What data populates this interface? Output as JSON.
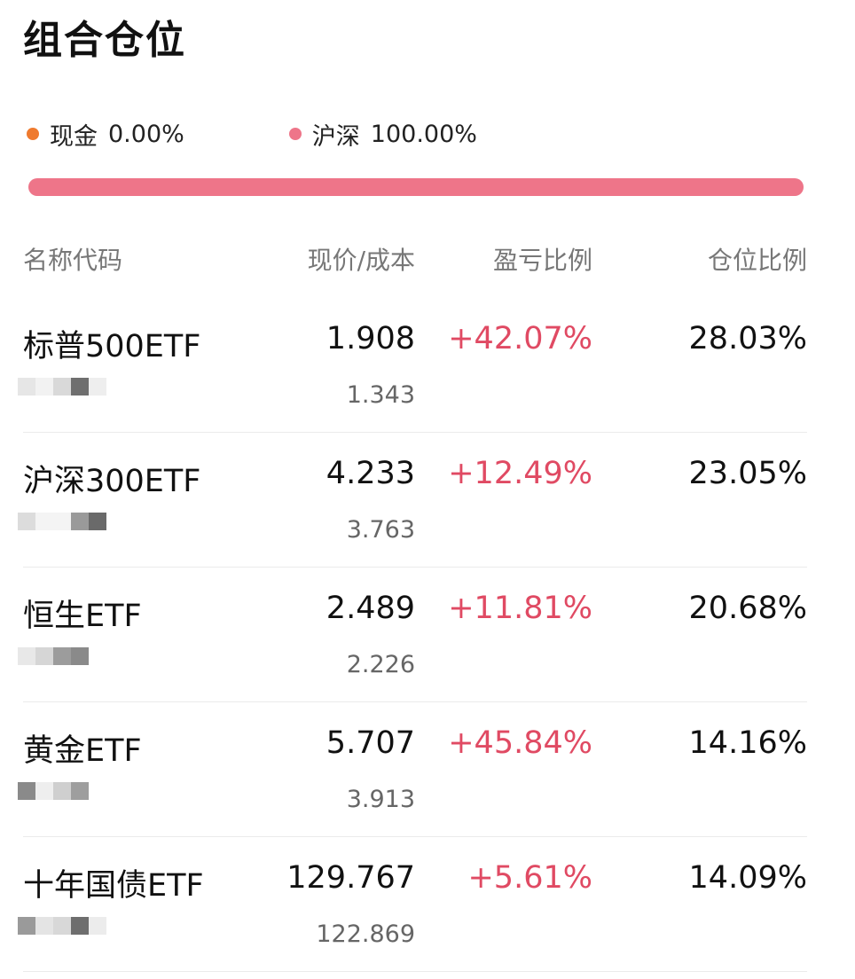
{
  "page": {
    "title": "组合仓位"
  },
  "allocation": [
    {
      "label": "现金",
      "percent": "0.00%",
      "value": 0.0,
      "color": "#ef7a2e"
    },
    {
      "label": "沪深",
      "percent": "100.00%",
      "value": 100.0,
      "color": "#ee7589"
    }
  ],
  "table": {
    "headers": {
      "name": "名称代码",
      "price": "现价/成本",
      "pnl": "盈亏比例",
      "position": "仓位比例"
    },
    "pnl_color": "#e04a63",
    "rows": [
      {
        "name": "标普500ETF",
        "price": "1.908",
        "cost": "1.343",
        "pnl": "+42.07%",
        "position": "28.03%"
      },
      {
        "name": "沪深300ETF",
        "price": "4.233",
        "cost": "3.763",
        "pnl": "+12.49%",
        "position": "23.05%"
      },
      {
        "name": "恒生ETF",
        "price": "2.489",
        "cost": "2.226",
        "pnl": "+11.81%",
        "position": "20.68%"
      },
      {
        "name": "黄金ETF",
        "price": "5.707",
        "cost": "3.913",
        "pnl": "+45.84%",
        "position": "14.16%"
      },
      {
        "name": "十年国债ETF",
        "price": "129.767",
        "cost": "122.869",
        "pnl": "+5.61%",
        "position": "14.09%"
      }
    ]
  }
}
